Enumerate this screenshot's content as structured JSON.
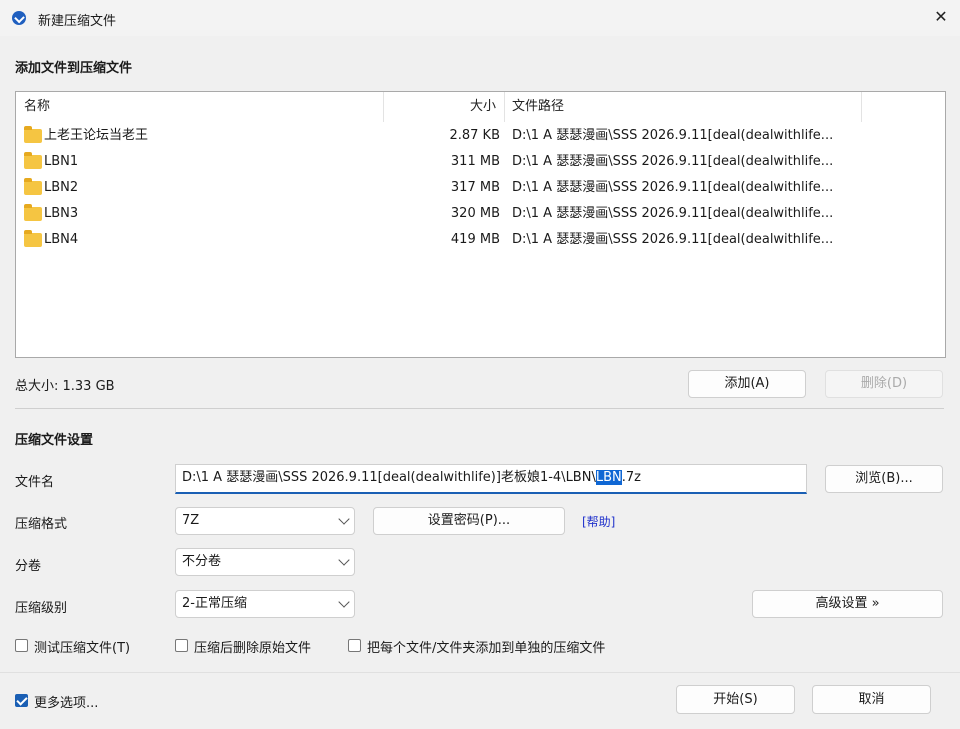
{
  "window": {
    "title": "新建压缩文件"
  },
  "files_section": {
    "title": "添加文件到压缩文件",
    "columns": {
      "name": "名称",
      "size": "大小",
      "path": "文件路径"
    },
    "rows": [
      {
        "name": "上老王论坛当老王",
        "size": "2.87 KB",
        "path": "D:\\1 A 瑟瑟漫画\\SSS 2026.9.11[deal(dealwithlife..."
      },
      {
        "name": "LBN1",
        "size": "311 MB",
        "path": "D:\\1 A 瑟瑟漫画\\SSS 2026.9.11[deal(dealwithlife..."
      },
      {
        "name": "LBN2",
        "size": "317 MB",
        "path": "D:\\1 A 瑟瑟漫画\\SSS 2026.9.11[deal(dealwithlife..."
      },
      {
        "name": "LBN3",
        "size": "320 MB",
        "path": "D:\\1 A 瑟瑟漫画\\SSS 2026.9.11[deal(dealwithlife..."
      },
      {
        "name": "LBN4",
        "size": "419 MB",
        "path": "D:\\1 A 瑟瑟漫画\\SSS 2026.9.11[deal(dealwithlife..."
      }
    ],
    "total_size": "总大小: 1.33 GB",
    "add_label": "添加(A)",
    "delete_label": "删除(D)"
  },
  "settings": {
    "title": "压缩文件设置",
    "filename_label": "文件名",
    "filename_prefix": "D:\\1 A 瑟瑟漫画\\SSS 2026.9.11[deal(dealwithlife)]老板娘1-4\\LBN\\",
    "filename_selected": "LBN",
    "filename_suffix": ".7z",
    "browse_label": "浏览(B)...",
    "format_label": "压缩格式",
    "format_value": "7Z",
    "password_label": "设置密码(P)...",
    "help_label": "[帮助]",
    "volume_label": "分卷",
    "volume_value": "不分卷",
    "level_label": "压缩级别",
    "level_value": "2-正常压缩",
    "advanced_label": "高级设置 »",
    "test_label": "测试压缩文件(T)",
    "delete_after_label": "压缩后删除原始文件",
    "separate_label": "把每个文件/文件夹添加到单独的压缩文件"
  },
  "footer": {
    "more_options_label": "更多选项...",
    "start_label": "开始(S)",
    "cancel_label": "取消"
  }
}
